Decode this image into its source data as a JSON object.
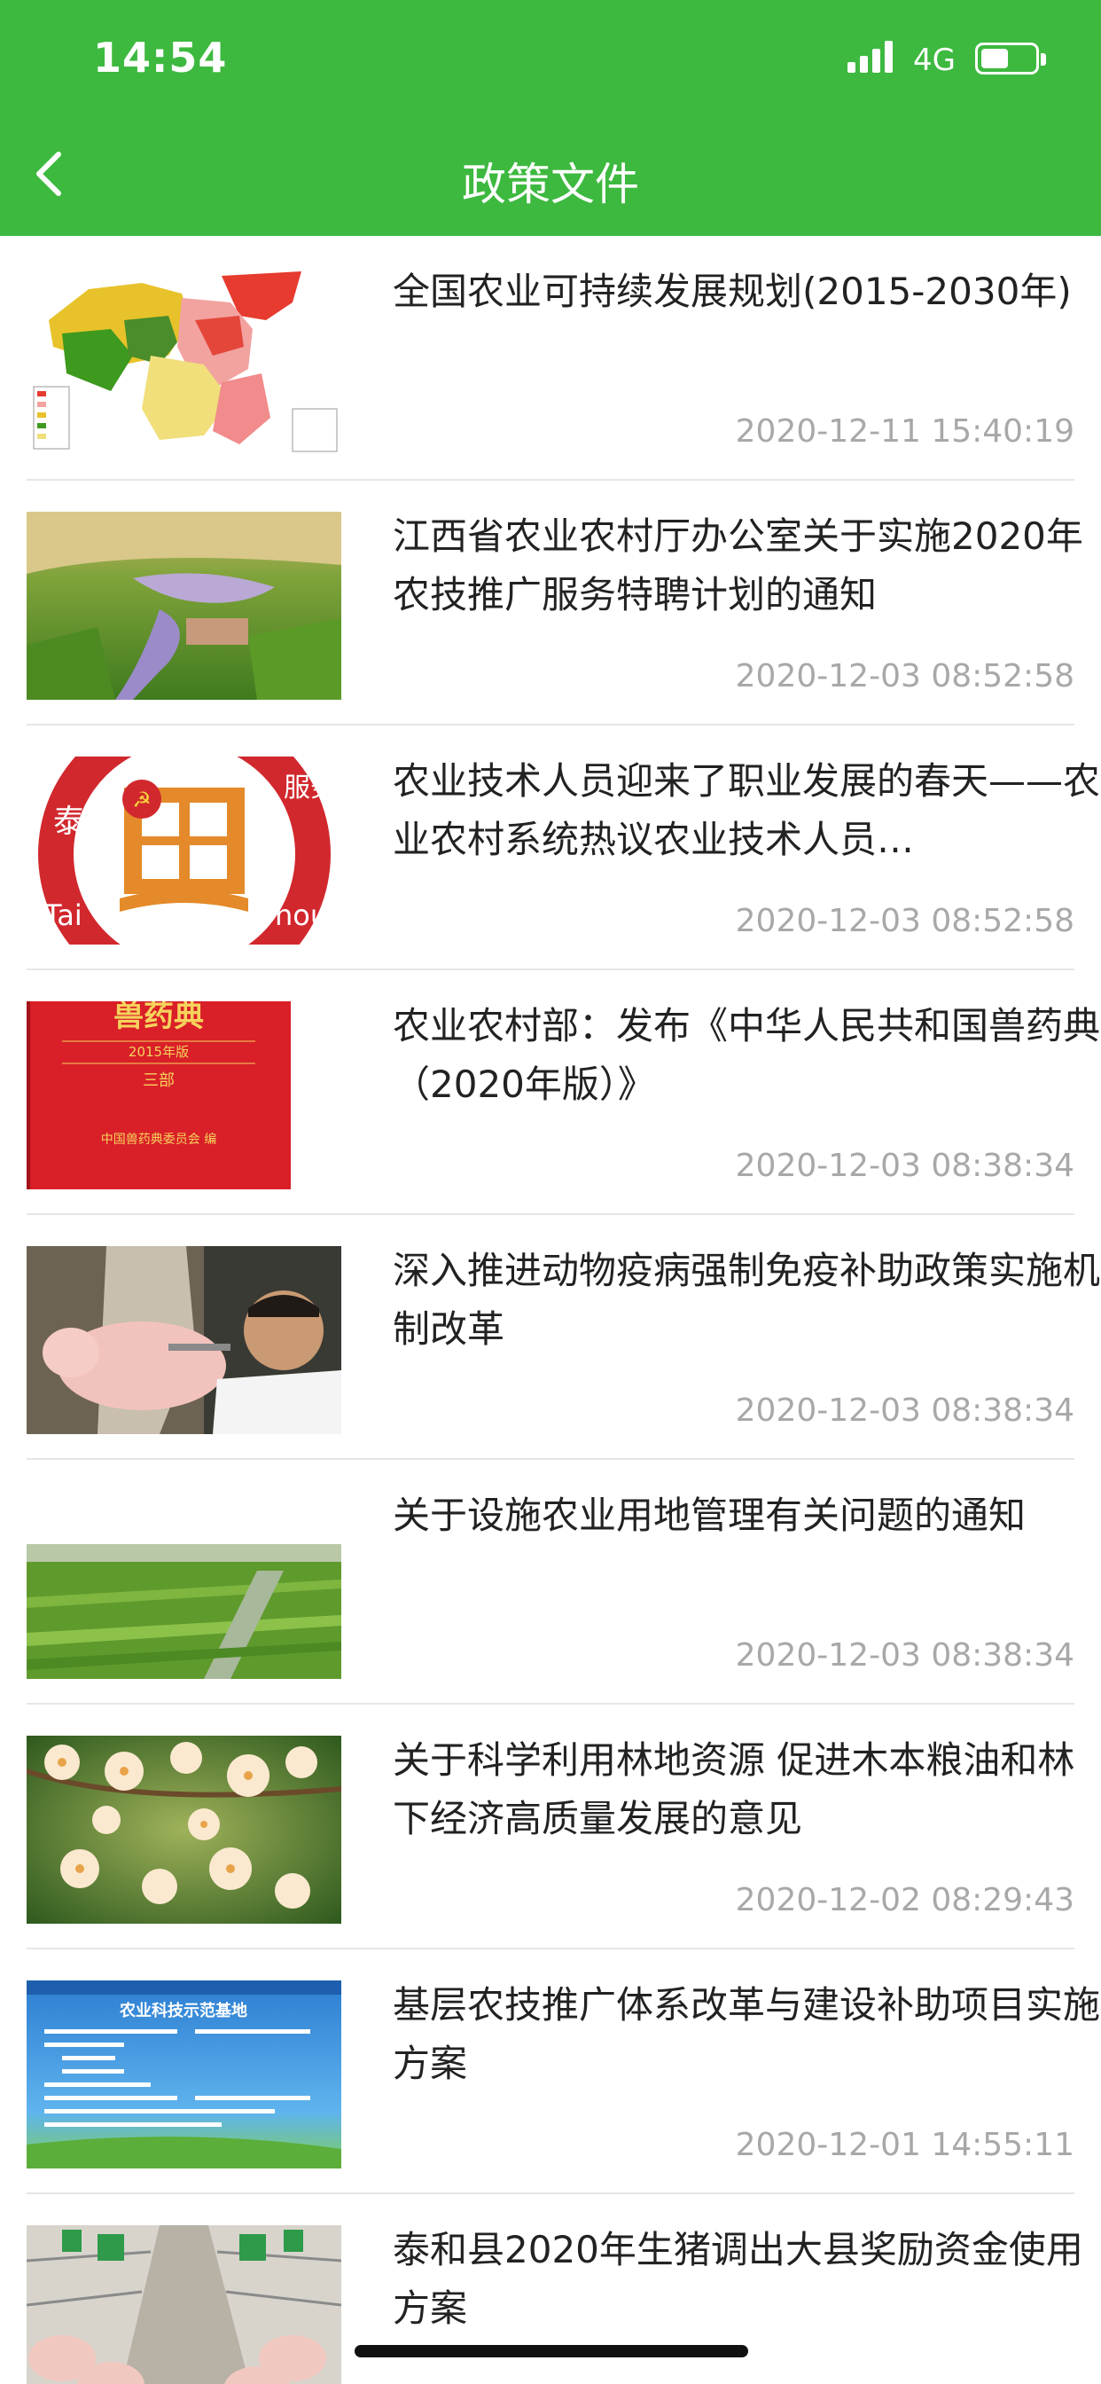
{
  "status_bar": {
    "time": "14:54",
    "network": "4G"
  },
  "header": {
    "title": "政策文件"
  },
  "items": [
    {
      "title": "全国农业可持续发展规划(2015-2030年)",
      "date": "2020-12-11 15:40:19",
      "thumb": "china-map"
    },
    {
      "title": "江西省农业农村厅办公室关于实施2020年农技推广服务特聘计划的通知",
      "date": "2020-12-03 08:52:58",
      "thumb": "farmland-lake"
    },
    {
      "title": "农业技术人员迎来了职业发展的春天——农业农村系统热议农业技术人员…",
      "date": "2020-12-03 08:52:58",
      "thumb": "service-emblem"
    },
    {
      "title": "农业农村部：发布《中华人民共和国兽药典（2020年版）》",
      "date": "2020-12-03 08:38:34",
      "thumb": "red-book"
    },
    {
      "title": "深入推进动物疫病强制免疫补助政策实施机制改革",
      "date": "2020-12-03 08:38:34",
      "thumb": "pig-vaccination"
    },
    {
      "title": "关于设施农业用地管理有关问题的通知",
      "date": "2020-12-03 08:38:34",
      "thumb": "green-fields"
    },
    {
      "title": "关于科学利用林地资源 促进木本粮油和林下经济高质量发展的意见",
      "date": "2020-12-02 08:29:43",
      "thumb": "flowers"
    },
    {
      "title": "基层农技推广体系改革与建设补助项目实施方案",
      "date": "2020-12-01 14:55:11",
      "thumb": "demo-sign"
    },
    {
      "title": "泰和县2020年生猪调出大县奖励资金使用方案",
      "date": "",
      "thumb": "pig-farm"
    }
  ],
  "thumb_texts": {
    "emblem_left": "泰和",
    "emblem_right": "服务团",
    "emblem_bottom_left": "Tai",
    "emblem_bottom_right": "hou",
    "book_title": "兽药典",
    "book_edition": "2015年版",
    "book_part": "三部",
    "book_publisher": "中国兽药典委员会 编",
    "sign_title": "农业科技示范基地"
  }
}
